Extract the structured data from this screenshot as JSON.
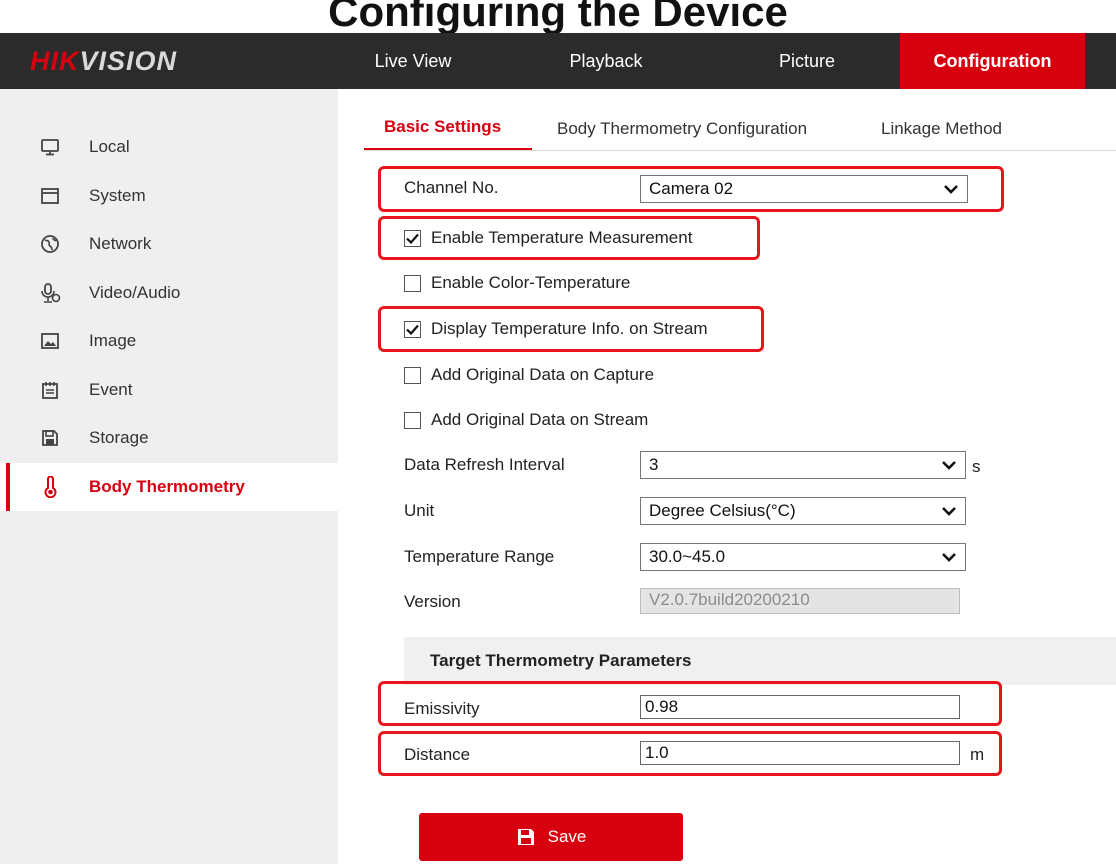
{
  "page_heading": "Configuring the Device",
  "brand": {
    "hik": "HIK",
    "vision": "VISION"
  },
  "nav": [
    {
      "label": "Live View"
    },
    {
      "label": "Playback"
    },
    {
      "label": "Picture"
    },
    {
      "label": "Configuration",
      "active": true
    }
  ],
  "sidebar": {
    "items": [
      {
        "label": "Local",
        "icon": "monitor-icon"
      },
      {
        "label": "System",
        "icon": "system-icon"
      },
      {
        "label": "Network",
        "icon": "globe-icon"
      },
      {
        "label": "Video/Audio",
        "icon": "mic-icon"
      },
      {
        "label": "Image",
        "icon": "image-icon"
      },
      {
        "label": "Event",
        "icon": "calendar-icon"
      },
      {
        "label": "Storage",
        "icon": "floppy-icon"
      },
      {
        "label": "Body Thermometry",
        "icon": "thermometer-icon",
        "active": true
      }
    ]
  },
  "tabs": [
    {
      "label": "Basic Settings",
      "active": true
    },
    {
      "label": "Body Thermometry Configuration"
    },
    {
      "label": "Linkage Method"
    }
  ],
  "form": {
    "channel_label": "Channel No.",
    "channel_value": "Camera 02",
    "enable_temp_label": "Enable Temperature Measurement",
    "enable_temp_checked": true,
    "enable_color_label": "Enable Color-Temperature",
    "enable_color_checked": false,
    "display_info_label": "Display Temperature Info. on Stream",
    "display_info_checked": true,
    "add_capture_label": "Add Original Data on Capture",
    "add_capture_checked": false,
    "add_stream_label": "Add Original Data on Stream",
    "add_stream_checked": false,
    "refresh_label": "Data Refresh Interval",
    "refresh_value": "3",
    "refresh_unit": "s",
    "unit_label": "Unit",
    "unit_value": "Degree Celsius(°C)",
    "range_label": "Temperature Range",
    "range_value": "30.0~45.0",
    "version_label": "Version",
    "version_value": "V2.0.7build20200210"
  },
  "target_section": {
    "title": "Target Thermometry Parameters",
    "emissivity_label": "Emissivity",
    "emissivity_value": "0.98",
    "distance_label": "Distance",
    "distance_value": "1.0",
    "distance_unit": "m"
  },
  "save_label": "Save",
  "colors": {
    "brand_red": "#d7000f",
    "topbar": "#2b2b2b",
    "highlight": "#e8141b"
  }
}
